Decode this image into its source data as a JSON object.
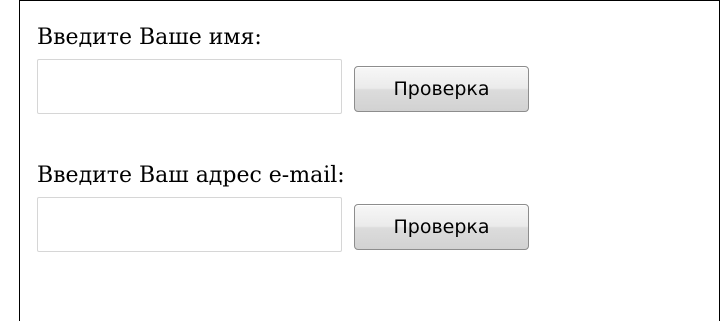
{
  "form": {
    "name_field": {
      "label": "Введите Ваше имя:",
      "value": "",
      "button_label": "Проверка"
    },
    "email_field": {
      "label": "Введите Ваш адрес e-mail:",
      "value": "",
      "button_label": "Проверка"
    }
  },
  "colors": {
    "frame_border": "#000000",
    "input_border": "#d6d6d6",
    "button_border": "#8d8d8d"
  }
}
